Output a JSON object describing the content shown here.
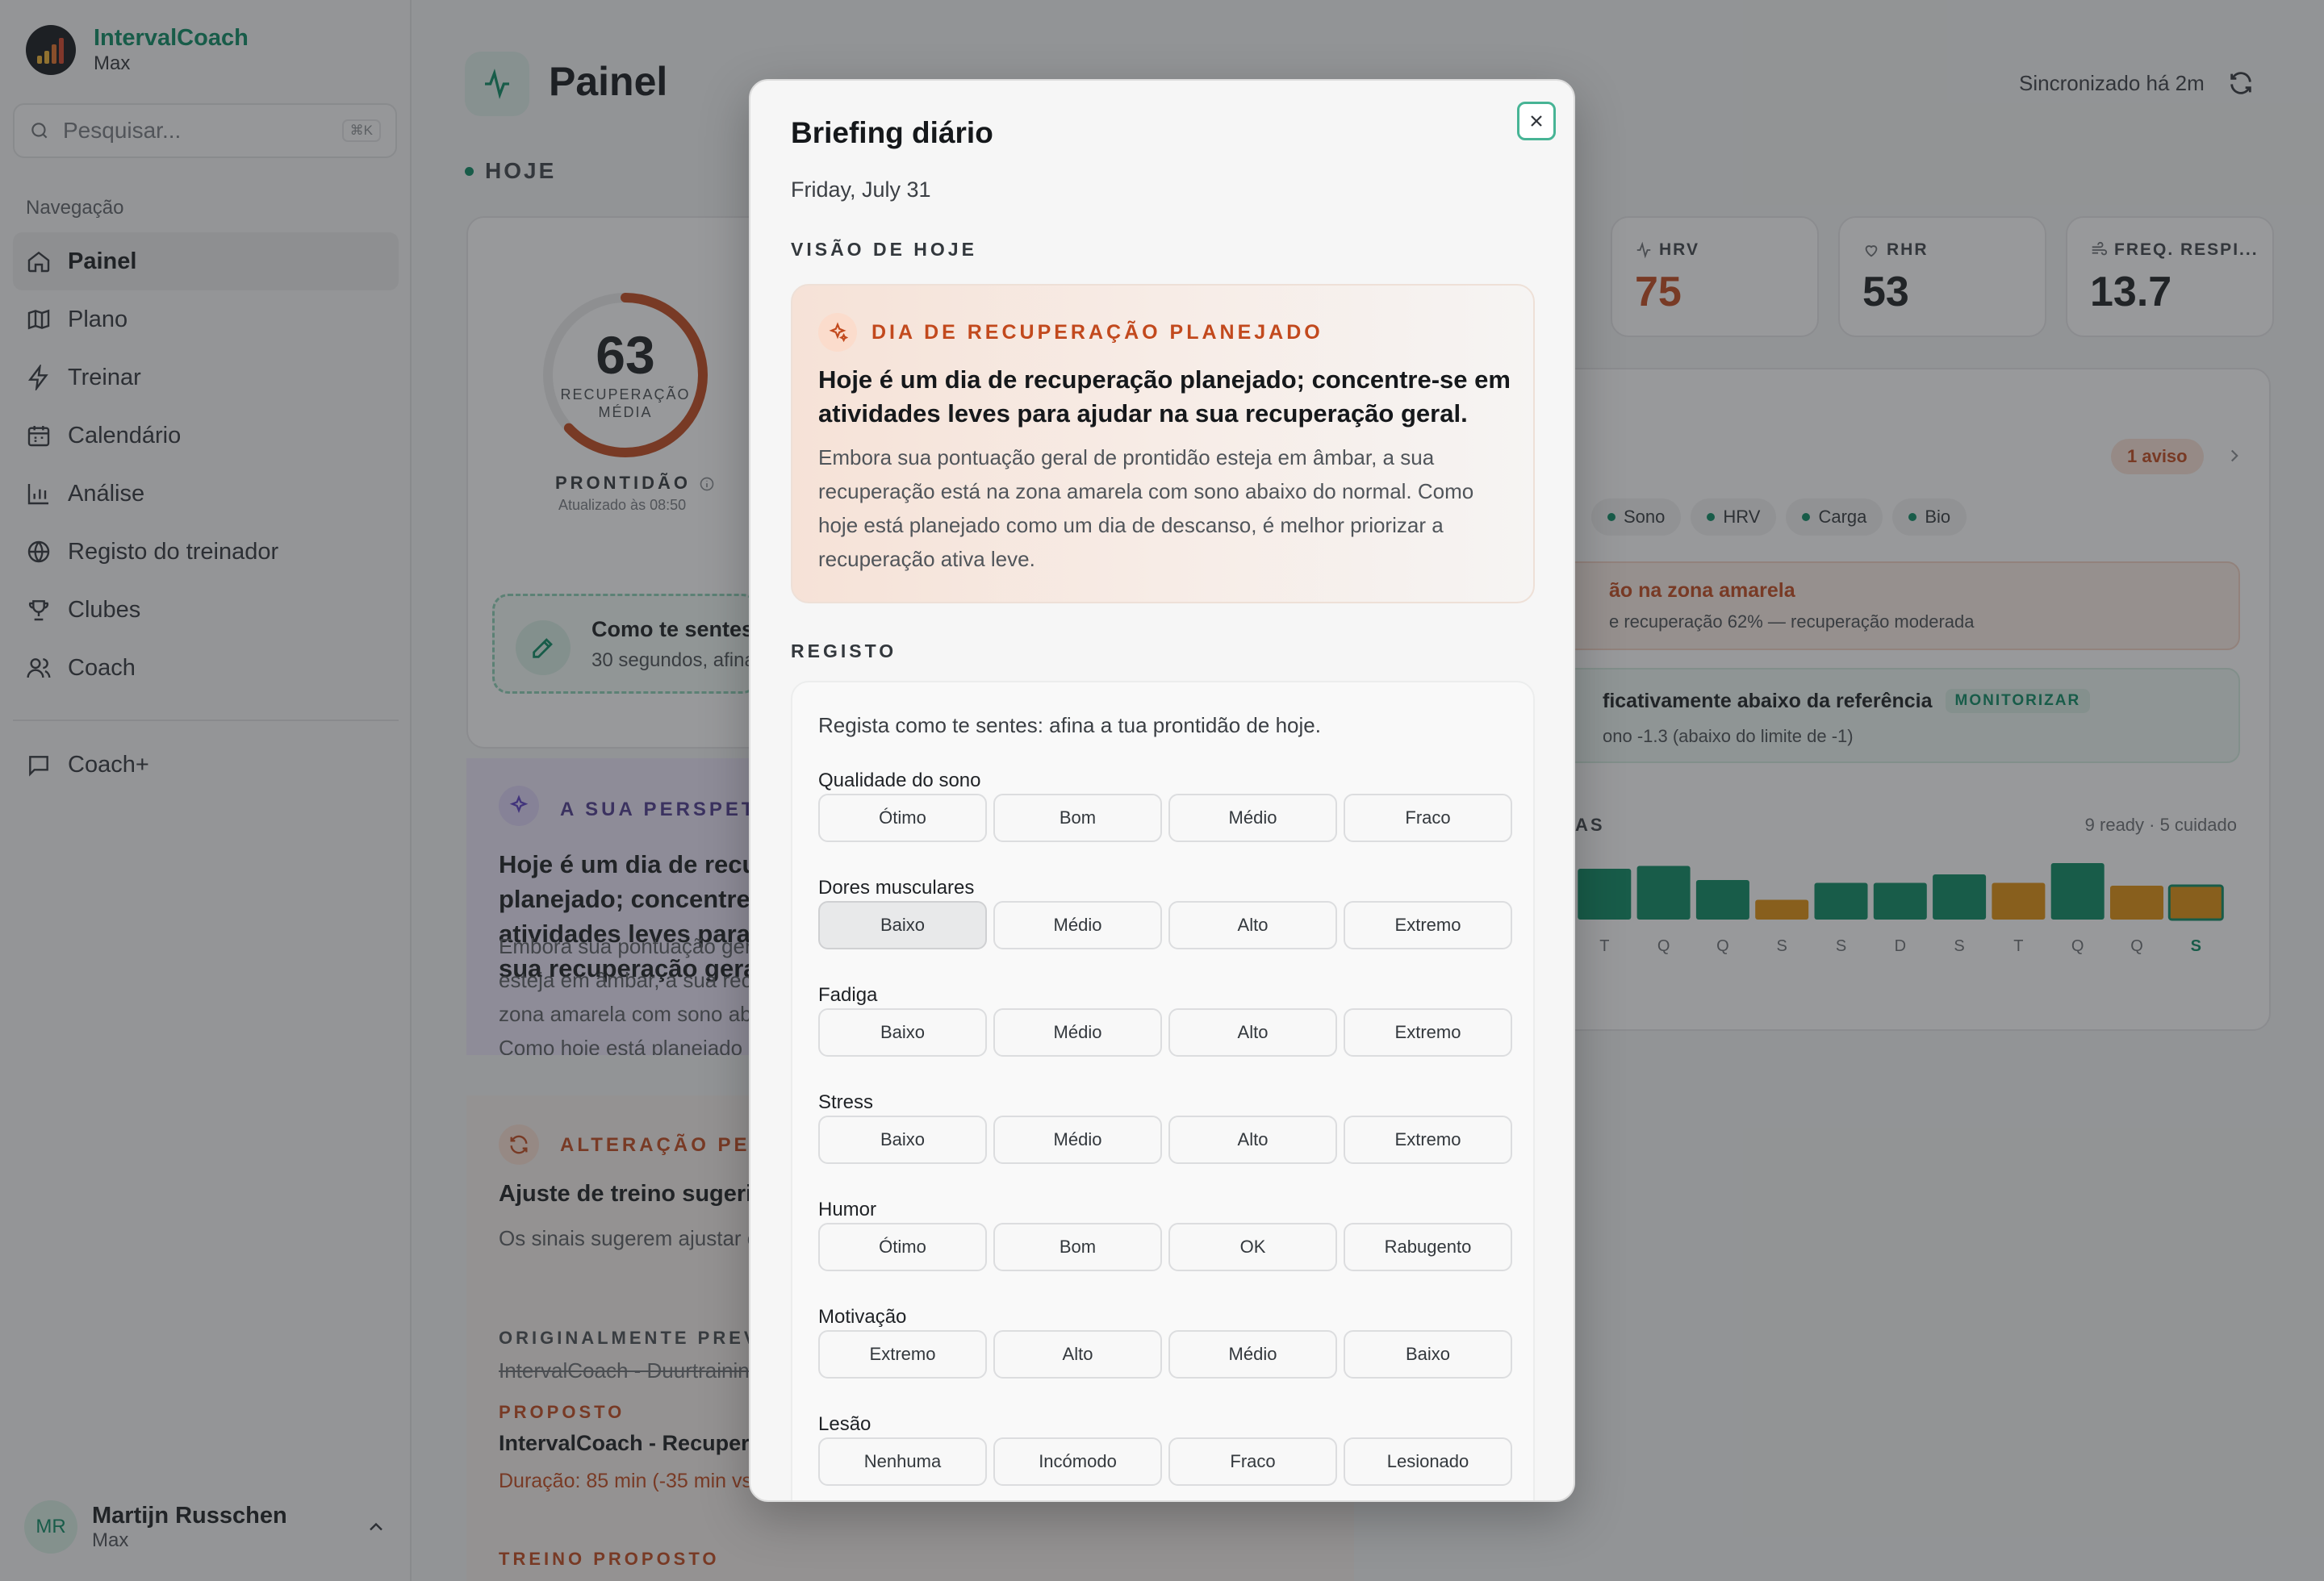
{
  "app": {
    "name": "IntervalCoach",
    "workspace": "Max"
  },
  "search": {
    "placeholder": "Pesquisar...",
    "shortcut": "⌘K"
  },
  "nav": {
    "label": "Navegação",
    "items": [
      {
        "label": "Painel",
        "icon": "home-icon",
        "active": true
      },
      {
        "label": "Plano",
        "icon": "map-icon"
      },
      {
        "label": "Treinar",
        "icon": "bolt-icon"
      },
      {
        "label": "Calendário",
        "icon": "calendar-icon"
      },
      {
        "label": "Análise",
        "icon": "bar-chart-icon"
      },
      {
        "label": "Registo do treinador",
        "icon": "globe-icon"
      },
      {
        "label": "Clubes",
        "icon": "trophy-icon"
      },
      {
        "label": "Coach",
        "icon": "users-icon"
      }
    ],
    "coach_plus": "Coach+"
  },
  "user": {
    "initials": "MR",
    "name": "Martijn Russchen",
    "workspace": "Max"
  },
  "header": {
    "title": "Painel",
    "sync": "Sincronizado há 2m"
  },
  "today": {
    "label": "HOJE"
  },
  "readiness": {
    "score": "63",
    "score_label": "RECUPERAÇÃO MÉDIA",
    "score_value": 63,
    "title": "PRONTIDÃO",
    "updated": "Atualizado às 08:50"
  },
  "feel": {
    "title": "Como te sentes",
    "subtitle": "30 segundos, afina"
  },
  "perspective": {
    "heading": "A SUA PERSPETIVA",
    "title": "Hoje é um dia de recuperação planejado; concentre-se em atividades leves para ajudar na sua recuperação geral.",
    "body": "Embora sua pontuação geral de prontidão esteja em âmbar, a sua recuperação está na zona amarela com sono abaixo do normal. Como hoje está planejado como um dia de descanso, é melhor priorizar a recuperação ativa leve."
  },
  "change": {
    "heading": "ALTERAÇÃO PENDENTE",
    "title": "Ajuste de treino sugerido",
    "body": "Os sinais sugerem ajustar o treino original.",
    "orig_label": "ORIGINALMENTE PREVISTO",
    "orig_value": "IntervalCoach - Duurtraining",
    "proposed_label": "PROPOSTO",
    "proposed_value": "IntervalCoach - Recuperação",
    "duration": "Duração: 85 min (-35 min vs",
    "proposed_workout": "TREINO PROPOSTO"
  },
  "metrics": [
    {
      "label": "HRV",
      "value": "75",
      "icon": "activity-icon",
      "color": "#c2491d"
    },
    {
      "label": "RHR",
      "value": "53",
      "icon": "heart-icon",
      "color": "#15181b"
    },
    {
      "label": "FREQ. RESPI...",
      "value": "13.7",
      "icon": "wind-icon",
      "color": "#15181b"
    }
  ],
  "signals": {
    "warnings": "1 aviso",
    "chips": [
      "Sono",
      "HRV",
      "Carga",
      "Bio"
    ],
    "alert1_title": "ão na zona amarela",
    "alert1_sub": "e recuperação 62% — recuperação moderada",
    "alert2_title": "ficativamente abaixo da referência",
    "alert2_badge": "MONITORIZAR",
    "alert2_sub": "ono -1.3 (abaixo do limite de -1)"
  },
  "week": {
    "heading": "AS",
    "summary": "9 ready · 5 cuidado",
    "days": [
      "T",
      "Q",
      "Q",
      "S",
      "S",
      "D",
      "S",
      "T",
      "Q",
      "Q",
      "S"
    ],
    "bar_levels": [
      0.55,
      0.9,
      0.95,
      0.7,
      0.35,
      0.65,
      0.65,
      0.8,
      0.65,
      1.0,
      0.6,
      0.6
    ],
    "bar_status": [
      "ready",
      "ready",
      "ready",
      "ready",
      "cuidado",
      "ready",
      "ready",
      "ready",
      "cuidado",
      "ready",
      "cuidado",
      "cuidado"
    ],
    "colors": {
      "ready": "#0a8a63",
      "cuidado": "#e0900f"
    }
  },
  "modal": {
    "title": "Briefing diário",
    "date": "Friday, July 31",
    "section_today": "VISÃO DE HOJE",
    "recovery_heading": "DIA DE RECUPERAÇÃO PLANEJADO",
    "recovery_title": "Hoje é um dia de recuperação planejado; concentre-se em atividades leves para ajudar na sua recuperação geral.",
    "recovery_body": "Embora sua pontuação geral de prontidão esteja em âmbar, a sua recuperação está na zona amarela com sono abaixo do normal. Como hoje está planejado como um dia de descanso, é melhor priorizar a recuperação ativa leve.",
    "section_register": "REGISTO",
    "register_intro": "Regista como te sentes: afina a tua prontidão de hoje.",
    "questions": [
      {
        "label": "Qualidade do sono",
        "options": [
          "Ótimo",
          "Bom",
          "Médio",
          "Fraco"
        ]
      },
      {
        "label": "Dores musculares",
        "options": [
          "Baixo",
          "Médio",
          "Alto",
          "Extremo"
        ],
        "selected": "Baixo"
      },
      {
        "label": "Fadiga",
        "options": [
          "Baixo",
          "Médio",
          "Alto",
          "Extremo"
        ]
      },
      {
        "label": "Stress",
        "options": [
          "Baixo",
          "Médio",
          "Alto",
          "Extremo"
        ]
      },
      {
        "label": "Humor",
        "options": [
          "Ótimo",
          "Bom",
          "OK",
          "Rabugento"
        ]
      },
      {
        "label": "Motivação",
        "options": [
          "Extremo",
          "Alto",
          "Médio",
          "Baixo"
        ]
      },
      {
        "label": "Lesão",
        "options": [
          "Nenhuma",
          "Incómodo",
          "Fraco",
          "Lesionado"
        ]
      }
    ]
  }
}
